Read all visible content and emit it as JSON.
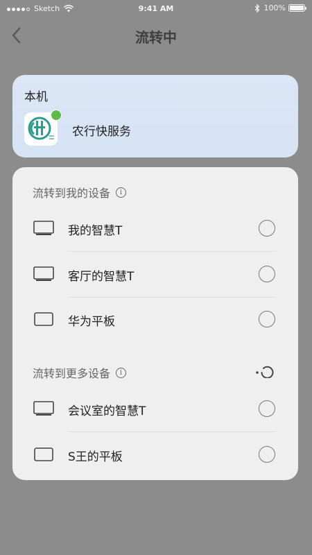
{
  "status_bar": {
    "carrier": "Sketch",
    "time": "9:41 AM",
    "battery": "100%"
  },
  "nav": {
    "title": "流转中",
    "back_icon": "chevron-left-icon"
  },
  "local": {
    "label": "本机",
    "app_name": "农行快服务",
    "app_icon": "abc-bank-icon",
    "badge_color": "#5dbb4c"
  },
  "my_devices": {
    "title": "流转到我的设备",
    "items": [
      {
        "label": "我的智慧T",
        "icon": "tv-icon"
      },
      {
        "label": "客厅的智慧T",
        "icon": "tv-icon"
      },
      {
        "label": "华为平板",
        "icon": "tablet-icon"
      }
    ]
  },
  "more_devices": {
    "title": "流转到更多设备",
    "items": [
      {
        "label": "会议室的智慧T",
        "icon": "tv-icon"
      },
      {
        "label": "S王的平板",
        "icon": "tablet-icon"
      }
    ]
  },
  "colors": {
    "local_card_bg": "#dbe7f7",
    "device_card_bg": "#efefef",
    "overlay": "#8c8c8c",
    "app_green": "#2e9c8c"
  }
}
